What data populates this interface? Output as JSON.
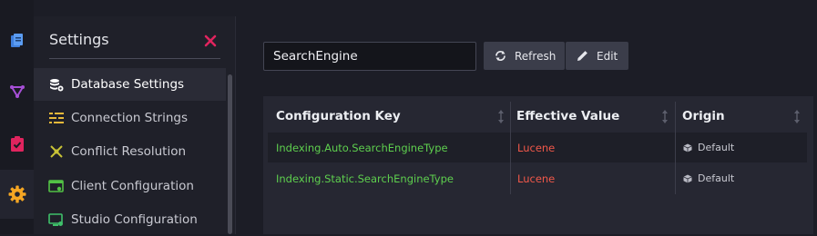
{
  "rail": {
    "items": [
      {
        "icon": "documents-icon"
      },
      {
        "icon": "indexes-icon"
      },
      {
        "icon": "tasks-icon"
      },
      {
        "icon": "settings-gear-icon"
      }
    ]
  },
  "sidebar": {
    "title": "Settings",
    "items": [
      {
        "label": "Database Settings",
        "icon": "database-settings-icon",
        "active": true
      },
      {
        "label": "Connection Strings",
        "icon": "connection-strings-icon"
      },
      {
        "label": "Conflict Resolution",
        "icon": "conflict-resolution-icon"
      },
      {
        "label": "Client Configuration",
        "icon": "client-configuration-icon"
      },
      {
        "label": "Studio Configuration",
        "icon": "studio-configuration-icon"
      }
    ]
  },
  "toolbar": {
    "search_value": "SearchEngine",
    "refresh_label": "Refresh",
    "edit_label": "Edit"
  },
  "table": {
    "headers": {
      "key": "Configuration Key",
      "value": "Effective Value",
      "origin": "Origin"
    },
    "rows": [
      {
        "key": "Indexing.Auto.SearchEngineType",
        "value": "Lucene",
        "origin": "Default"
      },
      {
        "key": "Indexing.Static.SearchEngineType",
        "value": "Lucene",
        "origin": "Default"
      }
    ]
  },
  "colors": {
    "accent_green": "#5ecf4e",
    "value_red": "#f1584a",
    "close_pink": "#e0245e",
    "gear_orange": "#f5a623"
  }
}
